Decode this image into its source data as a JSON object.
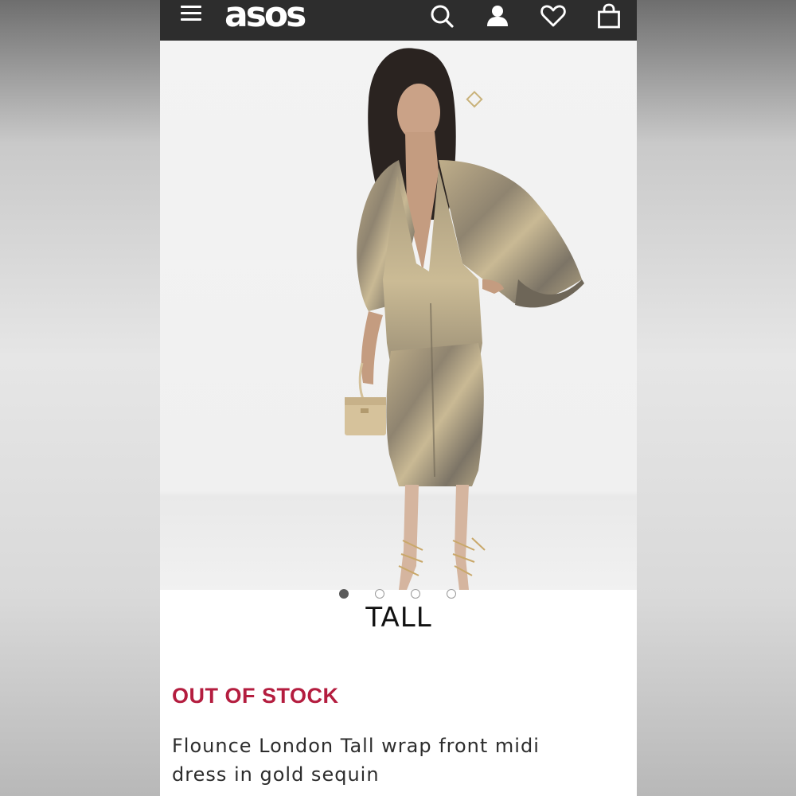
{
  "header": {
    "logo": "asos",
    "icons": [
      "menu-icon",
      "search-icon",
      "account-icon",
      "heart-icon",
      "bag-icon"
    ]
  },
  "gallery": {
    "images": 4,
    "current": 1,
    "badge": "TALL"
  },
  "product": {
    "stock_status": "OUT OF STOCK",
    "title": "Flounce London Tall wrap front midi dress in gold sequin"
  },
  "colors": {
    "header_bg": "#2d2d2d",
    "stock_red": "#b41d3f",
    "text": "#2d2d2d"
  }
}
